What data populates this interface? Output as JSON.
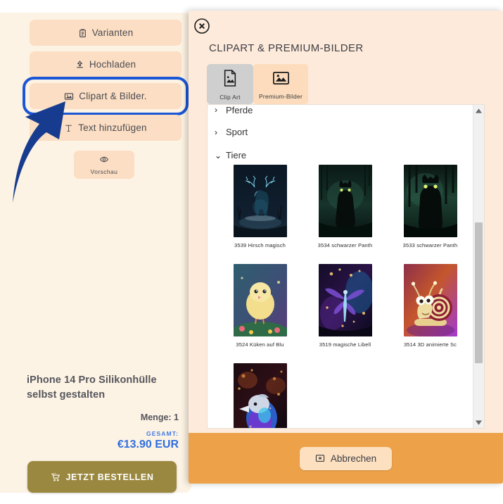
{
  "left_panel": {
    "tools": [
      {
        "label": "Varianten",
        "icon": "clipboard-icon",
        "selected": false
      },
      {
        "label": "Hochladen",
        "icon": "upload-icon",
        "selected": false
      },
      {
        "label": "Clipart & Bilder.",
        "icon": "image-icon",
        "selected": true
      },
      {
        "label": "Text hinzufügen",
        "icon": "text-icon",
        "selected": false
      }
    ],
    "preview": {
      "label": "Vorschau",
      "icon": "eye-icon"
    },
    "product": {
      "title": "iPhone 14 Pro Silikonhülle selbst gestalten",
      "quantity_label": "Menge: 1",
      "total_label": "GESAMT:",
      "total_value": "€13.90 EUR"
    },
    "order_button": {
      "label": "JETZT BESTELLEN",
      "icon": "cart-icon"
    }
  },
  "modal": {
    "close_icon": "close-circle-icon",
    "title": "CLIPART & PREMIUM-BILDER",
    "tabs": [
      {
        "label": "Clip Art",
        "icon": "file-image-icon",
        "active": true
      },
      {
        "label": "Premium-Bilder",
        "icon": "photo-icon",
        "active": false
      }
    ],
    "categories": [
      {
        "label": "Pferde",
        "expanded": false,
        "chevron": "chevron-right-icon"
      },
      {
        "label": "Sport",
        "expanded": false,
        "chevron": "chevron-right-icon"
      },
      {
        "label": "Tiere",
        "expanded": true,
        "chevron": "chevron-down-icon"
      }
    ],
    "items": [
      {
        "caption": "3539 Hirsch magisch",
        "art": "deer"
      },
      {
        "caption": "3534 schwarzer Panth",
        "art": "panther-a"
      },
      {
        "caption": "3533 schwarzer Panth",
        "art": "panther-b"
      },
      {
        "caption": "3524 Küken auf Blu",
        "art": "chick"
      },
      {
        "caption": "3519 magische Libell",
        "art": "dragonfly"
      },
      {
        "caption": "3514 3D animierte Sc",
        "art": "snail"
      },
      {
        "caption": "",
        "art": "bird"
      }
    ],
    "scrollbar": {
      "up_icon": "scroll-up-icon",
      "down_icon": "scroll-down-icon"
    },
    "footer": {
      "cancel_label": "Abbrechen",
      "cancel_icon": "cancel-box-icon"
    }
  },
  "annotation": {
    "arrow": "blue-arrow-pointing-to-clipart-button"
  },
  "colors": {
    "panel_bg": "#fdf3e4",
    "tool_bg": "#fbdec3",
    "highlight_blue": "#1a56d6",
    "modal_bg": "#fdeada",
    "footer_orange": "#eda24a",
    "order_olive": "#9a8840",
    "price_blue": "#2f6fe0"
  }
}
